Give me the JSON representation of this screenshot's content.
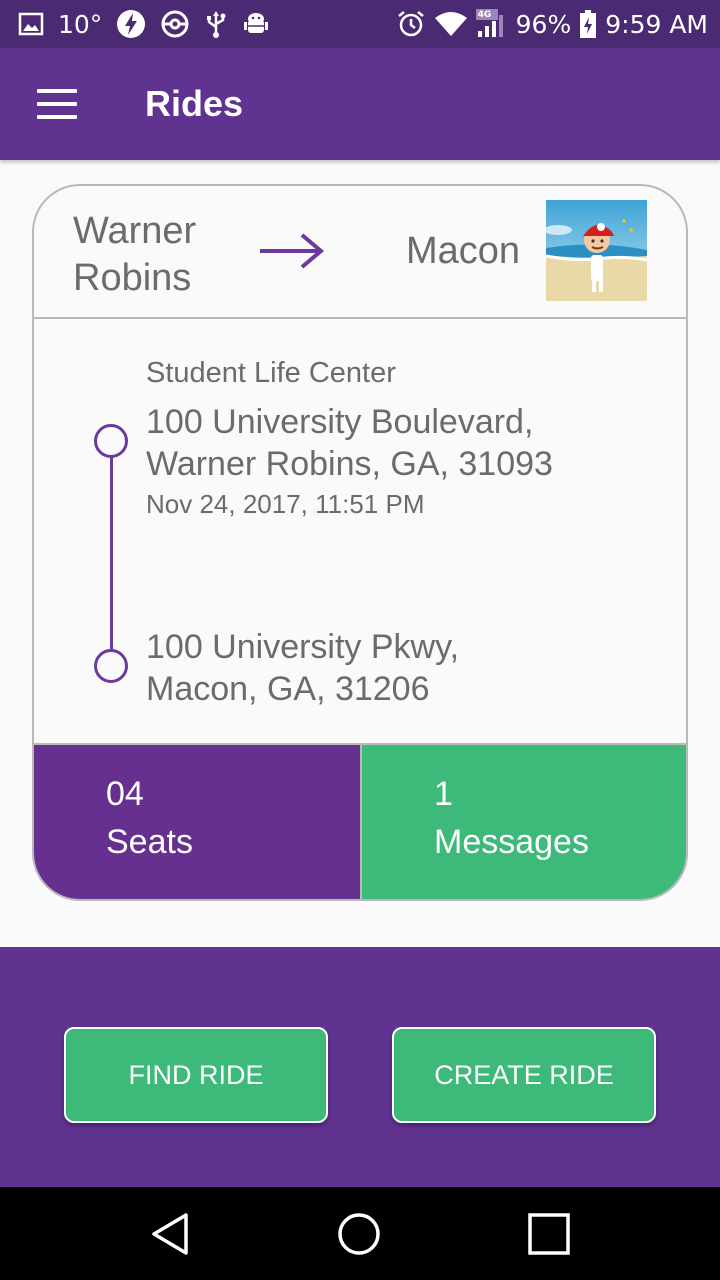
{
  "status_bar": {
    "temperature": "10°",
    "battery": "96%",
    "time": "9:59 AM",
    "network": "4G",
    "icons_left": [
      "image-icon",
      "flash-icon",
      "pokeball-icon",
      "usb-icon",
      "android-debug-icon"
    ],
    "icons_right": [
      "alarm-icon",
      "wifi-icon",
      "signal-icon",
      "battery-icon"
    ]
  },
  "app_bar": {
    "title": "Rides",
    "menu_icon": "menu-icon"
  },
  "ride": {
    "from_city": "Warner Robins",
    "to_city": "Macon",
    "pickup_name": "Student Life Center",
    "pickup_address_line1": "100 University Boulevard,",
    "pickup_address_line2": "Warner Robins, GA, 31093",
    "pickup_datetime": "Nov 24, 2017, 11:51 PM",
    "dropoff_address_line1": "100 University Pkwy,",
    "dropoff_address_line2": "Macon, GA, 31206",
    "seats_count": "04",
    "seats_label": "Seats",
    "messages_count": "1",
    "messages_label": "Messages"
  },
  "actions": {
    "find_ride": "FIND RIDE",
    "create_ride": "CREATE RIDE"
  },
  "colors": {
    "primary": "#613391",
    "status_bar": "#4a2a72",
    "accent_green": "#3dba79",
    "text_gray": "#6b6b6b"
  },
  "nav_bar": {
    "icons": [
      "back-icon",
      "home-icon",
      "recents-icon"
    ]
  }
}
